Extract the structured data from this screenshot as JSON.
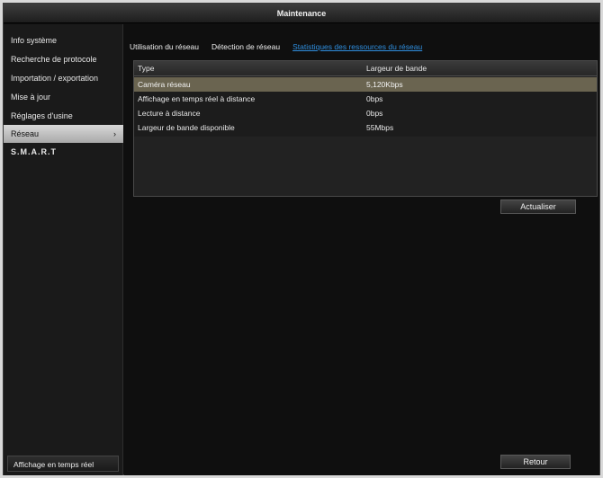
{
  "title": "Maintenance",
  "sidebar": {
    "items": [
      {
        "label": "Info système"
      },
      {
        "label": "Recherche de protocole"
      },
      {
        "label": "Importation / exportation"
      },
      {
        "label": "Mise à jour"
      },
      {
        "label": "Réglages d'usine"
      },
      {
        "label": "Réseau",
        "active": true
      },
      {
        "label": "S.M.A.R.T"
      }
    ],
    "live_view_label": "Affichage en temps réel"
  },
  "tabs": [
    {
      "label": "Utilisation du réseau"
    },
    {
      "label": "Détection de réseau"
    },
    {
      "label": "Statistiques des ressources du réseau",
      "active": true
    }
  ],
  "table": {
    "headers": [
      "Type",
      "Largeur de bande"
    ],
    "rows": [
      {
        "type": "Caméra réseau",
        "bandwidth": "5,120Kbps",
        "selected": true
      },
      {
        "type": "Affichage en temps réel à distance",
        "bandwidth": "0bps"
      },
      {
        "type": "Lecture à distance",
        "bandwidth": "0bps"
      },
      {
        "type": "Largeur de bande disponible",
        "bandwidth": "55Mbps"
      }
    ]
  },
  "buttons": {
    "refresh": "Actualiser",
    "back": "Retour"
  },
  "colors": {
    "accent_tab": "#2f8fe0",
    "selected_row": "#6a6450",
    "active_menu": "#c8c8c8"
  }
}
